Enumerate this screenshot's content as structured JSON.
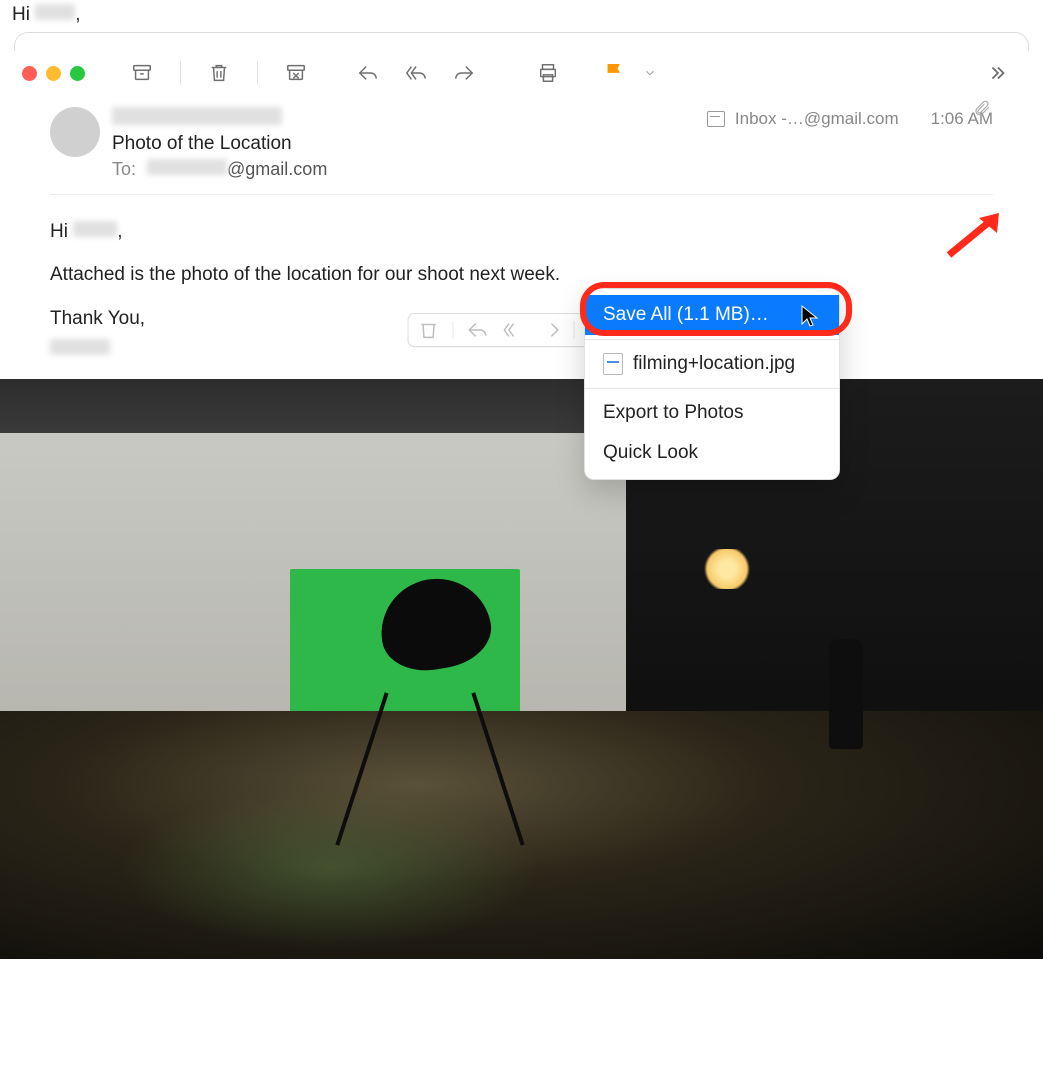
{
  "peek": {
    "greeting_prefix": "Hi ",
    "greeting_name_masked": "      ",
    "greeting_suffix": ","
  },
  "toolbar": {
    "archive": "Archive",
    "delete": "Delete",
    "junk": "Junk",
    "reply": "Reply",
    "reply_all": "Reply All",
    "forward": "Forward",
    "print": "Print",
    "flag": "Flag",
    "more": "More"
  },
  "header": {
    "from_masked": "              ",
    "subject": "Photo of the Location",
    "to_label": "To: ",
    "to_prefix_masked": "          ",
    "to_suffix": "@gmail.com",
    "mailbox": "Inbox -…@gmail.com",
    "time": "1:06 AM",
    "attachment_count": "1"
  },
  "body": {
    "greeting_prefix": "Hi ",
    "greeting_name_masked": "      ",
    "greeting_suffix": ",",
    "line1": "Attached is the photo of the location for our shoot next week.",
    "signoff": "Thank You,",
    "sig_masked": "        "
  },
  "menu": {
    "save_all": "Save All (1.1 MB)…",
    "file": "filming+location.jpg",
    "export": "Export to Photos",
    "quick_look": "Quick Look"
  }
}
